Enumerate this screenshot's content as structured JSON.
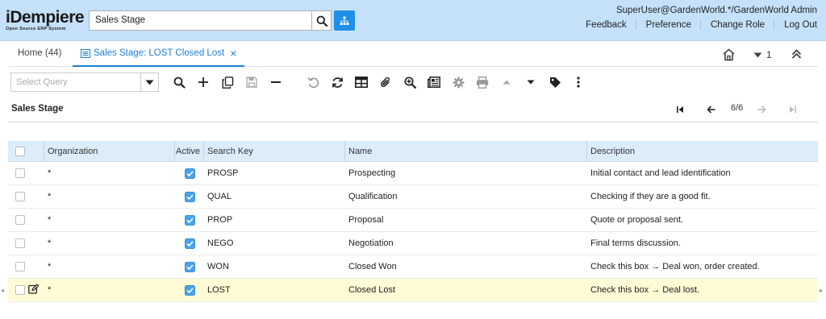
{
  "header": {
    "logo_main": "iDempiere",
    "logo_sub": "Open Source ERP System",
    "search_value": "Sales Stage",
    "user": "SuperUser@GardenWorld.*/GardenWorld Admin",
    "links": [
      "Feedback",
      "Preference",
      "Change Role",
      "Log Out"
    ]
  },
  "tabs": {
    "home": "Home (44)",
    "active": "Sales Stage: LOST Closed Lost",
    "close_glyph": "×",
    "right_count": "1"
  },
  "toolbar": {
    "query_placeholder": "Select Query",
    "icons": [
      "search-icon",
      "new-record-icon",
      "copy-icon",
      "save-icon",
      "delete-icon",
      "undo-icon",
      "refresh-icon",
      "grid-toggle-icon",
      "attachment-icon",
      "zoom-icon",
      "report-icon",
      "settings-icon",
      "print-icon",
      "previous-icon",
      "next-icon",
      "tag-icon",
      "more-icon"
    ]
  },
  "grid": {
    "title": "Sales Stage",
    "record_counter": "6/6",
    "columns": [
      "Organization",
      "Active",
      "Search Key",
      "Name",
      "Description"
    ],
    "rows": [
      {
        "org": "*",
        "active": true,
        "key": "PROSP",
        "name": "Prospecting",
        "description": "Initial contact and lead identification"
      },
      {
        "org": "*",
        "active": true,
        "key": "QUAL",
        "name": "Qualification",
        "description": "Checking if they are a good fit."
      },
      {
        "org": "*",
        "active": true,
        "key": "PROP",
        "name": "Proposal",
        "description": "Quote or proposal sent."
      },
      {
        "org": "*",
        "active": true,
        "key": "NEGO",
        "name": "Negotiation",
        "description": "Final terms discussion."
      },
      {
        "org": "*",
        "active": true,
        "key": "WON",
        "name": "Closed Won",
        "description": "Check this box → Deal won, order created."
      },
      {
        "org": "*",
        "active": true,
        "key": "LOST",
        "name": "Closed Lost",
        "description": "Check this box → Deal lost."
      }
    ]
  },
  "colors": {
    "header_bg": "#c5e1fa",
    "accent": "#1d80d0",
    "grid_header_bg": "#dcecf9",
    "selected_row_bg": "#fffbd6",
    "checkbox_checked": "#4aa3ea"
  }
}
